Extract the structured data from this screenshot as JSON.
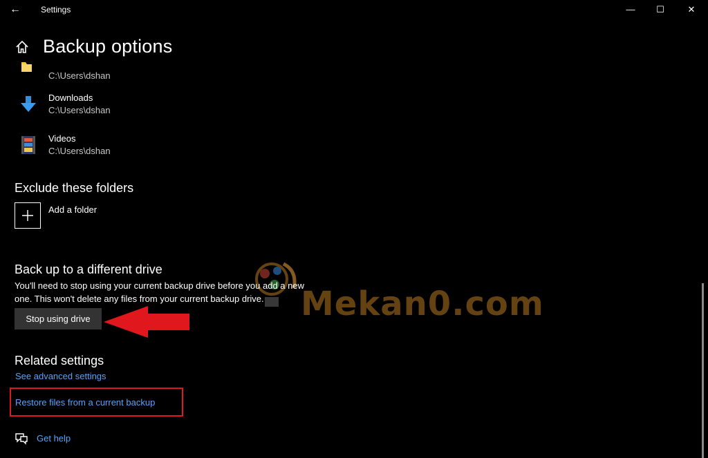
{
  "window": {
    "title": "Settings"
  },
  "page": {
    "title": "Backup options"
  },
  "folders": [
    {
      "name": "",
      "path": "C:\\Users\\dshan",
      "icon": "folder-icon"
    },
    {
      "name": "Downloads",
      "path": "C:\\Users\\dshan",
      "icon": "downloads-icon"
    },
    {
      "name": "Videos",
      "path": "C:\\Users\\dshan",
      "icon": "videos-icon"
    }
  ],
  "exclude": {
    "heading": "Exclude these folders",
    "add_label": "Add a folder"
  },
  "drive": {
    "heading": "Back up to a different drive",
    "description": "You'll need to stop using your current backup drive before you add a new one. This won't delete any files from your current backup drive.",
    "button_label": "Stop using drive"
  },
  "related": {
    "heading": "Related settings",
    "advanced_link": "See advanced settings",
    "restore_link": "Restore files from a current backup"
  },
  "help": {
    "label": "Get help"
  },
  "watermark": {
    "text": "Mekan0.com"
  },
  "colors": {
    "background": "#000000",
    "link": "#5aa3f5",
    "annotation": "#e0181e",
    "button": "#333333"
  }
}
